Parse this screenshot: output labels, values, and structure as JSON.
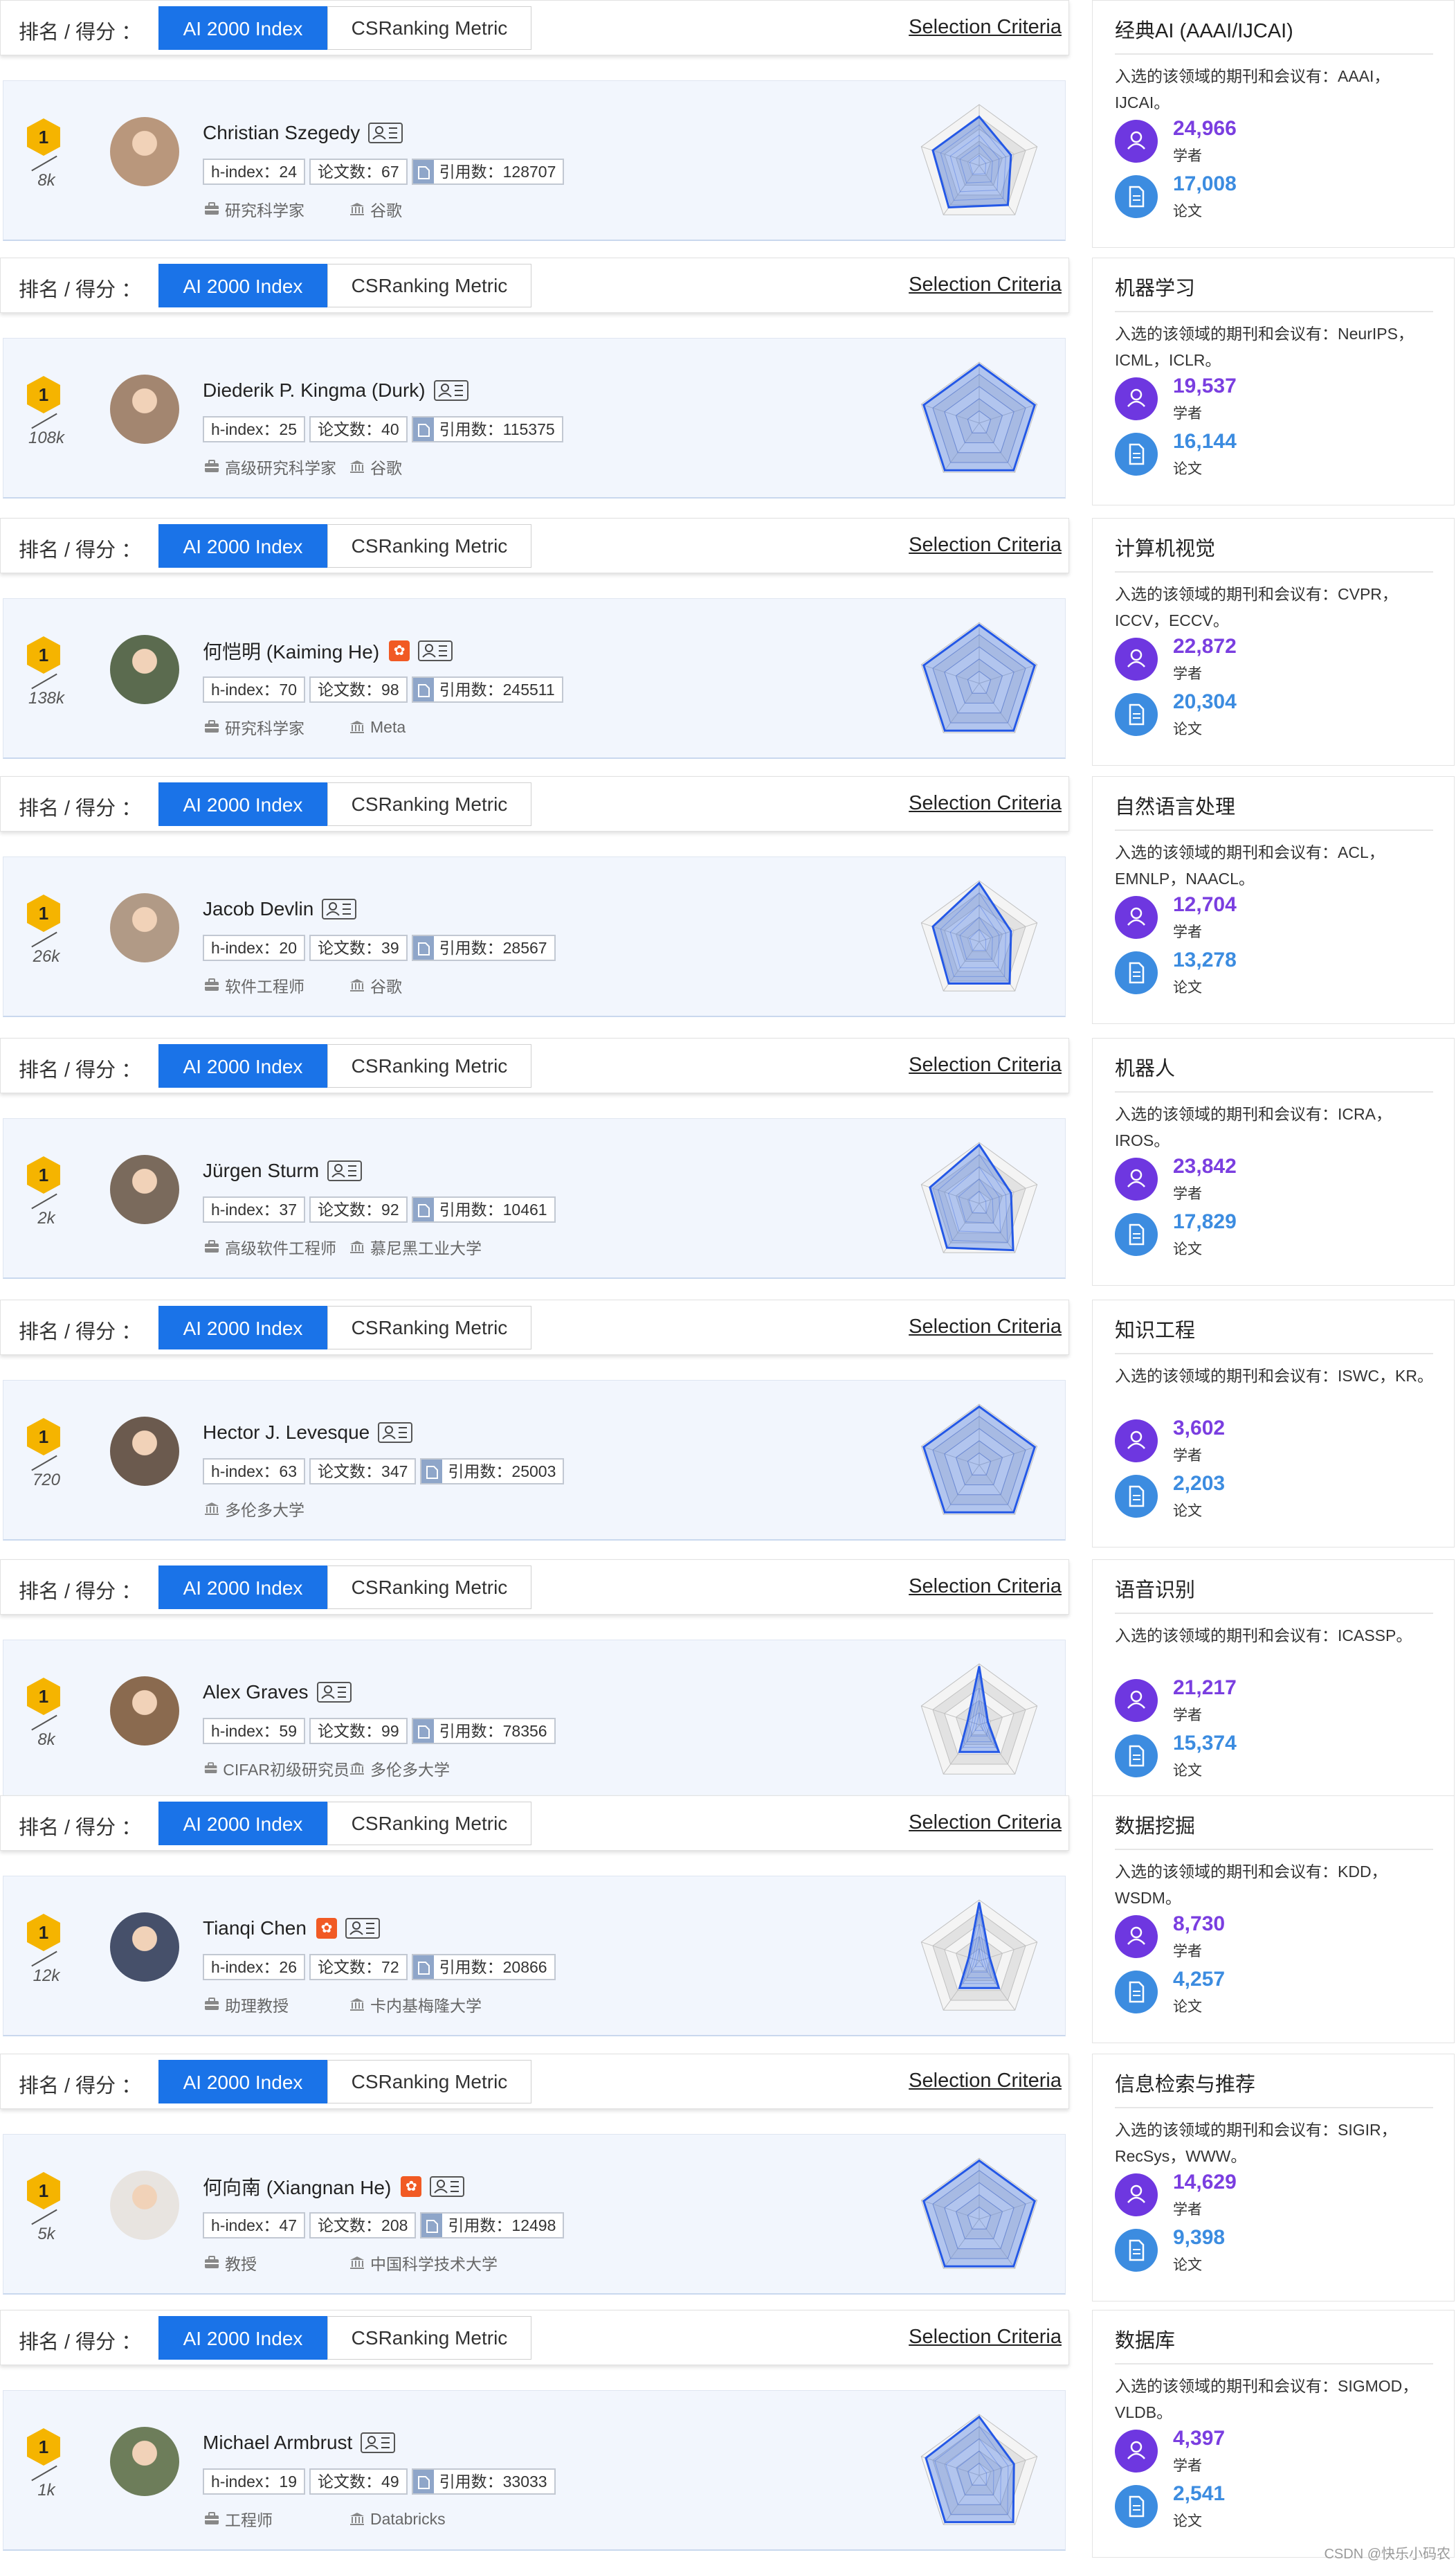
{
  "tabs": {
    "rank_label": "排名 / 得分 ：",
    "ai_index": "AI 2000 Index",
    "csranking": "CSRanking Metric",
    "selection": "Selection Criteria"
  },
  "scholars": [
    {
      "rank": "1",
      "score": "8k",
      "name": "Christian Szegedy",
      "huawei": false,
      "hindex": "h-index：24",
      "papers": "论文数：67",
      "citations": "引用数：128707",
      "position": "研究科学家",
      "org": "谷歌",
      "avatar_color": "#b9977c"
    },
    {
      "rank": "1",
      "score": "108k",
      "name": "Diederik P. Kingma (Durk)",
      "huawei": false,
      "hindex": "h-index：25",
      "papers": "论文数：40",
      "citations": "引用数：115375",
      "position": "高级研究科学家",
      "org": "谷歌",
      "avatar_color": "#a38670"
    },
    {
      "rank": "1",
      "score": "138k",
      "name": "何恺明 (Kaiming He)",
      "huawei": true,
      "hindex": "h-index：70",
      "papers": "论文数：98",
      "citations": "引用数：245511",
      "position": "研究科学家",
      "org": "Meta",
      "avatar_color": "#5b6b4f"
    },
    {
      "rank": "1",
      "score": "26k",
      "name": "Jacob Devlin",
      "huawei": false,
      "hindex": "h-index：20",
      "papers": "论文数：39",
      "citations": "引用数：28567",
      "position": "软件工程师",
      "org": "谷歌",
      "avatar_color": "#b19a86"
    },
    {
      "rank": "1",
      "score": "2k",
      "name": "Jürgen Sturm",
      "huawei": false,
      "hindex": "h-index：37",
      "papers": "论文数：92",
      "citations": "引用数：10461",
      "position": "高级软件工程师",
      "org": "慕尼黑工业大学",
      "avatar_color": "#7a6a5c"
    },
    {
      "rank": "1",
      "score": "720",
      "name": "Hector J. Levesque",
      "huawei": false,
      "hindex": "h-index：63",
      "papers": "论文数：347",
      "citations": "引用数：25003",
      "position": "",
      "org": "多伦多大学",
      "avatar_color": "#6b5a4e"
    },
    {
      "rank": "1",
      "score": "8k",
      "name": "Alex Graves",
      "huawei": false,
      "hindex": "h-index：59",
      "papers": "论文数：99",
      "citations": "引用数：78356",
      "position": "CIFAR初级研究员",
      "org": "多伦多大学",
      "avatar_color": "#8a6a4f"
    },
    {
      "rank": "1",
      "score": "12k",
      "name": "Tianqi Chen",
      "huawei": true,
      "hindex": "h-index：26",
      "papers": "论文数：72",
      "citations": "引用数：20866",
      "position": "助理教授",
      "org": "卡内基梅隆大学",
      "avatar_color": "#46506a"
    },
    {
      "rank": "1",
      "score": "5k",
      "name": "何向南 (Xiangnan He)",
      "huawei": true,
      "hindex": "h-index：47",
      "papers": "论文数：208",
      "citations": "引用数：12498",
      "position": "教授",
      "org": "中国科学技术大学",
      "avatar_color": "#e8e4e0"
    },
    {
      "rank": "1",
      "score": "1k",
      "name": "Michael Armbrust",
      "huawei": false,
      "hindex": "h-index：19",
      "papers": "论文数：49",
      "citations": "引用数：33033",
      "position": "工程师",
      "org": "Databricks",
      "avatar_color": "#6d7d5a"
    }
  ],
  "domains": [
    {
      "title": "经典AI (AAAI/IJCAI)",
      "desc": "入选的该领域的期刊和会议有：AAAI，IJCAI。",
      "scholars": "24,966",
      "papers": "17,008"
    },
    {
      "title": "机器学习",
      "desc": "入选的该领域的期刊和会议有：NeurIPS，ICML，ICLR。",
      "scholars": "19,537",
      "papers": "16,144"
    },
    {
      "title": "计算机视觉",
      "desc": "入选的该领域的期刊和会议有：CVPR，ICCV，ECCV。",
      "scholars": "22,872",
      "papers": "20,304"
    },
    {
      "title": "自然语言处理",
      "desc": "入选的该领域的期刊和会议有：ACL，EMNLP，NAACL。",
      "scholars": "12,704",
      "papers": "13,278"
    },
    {
      "title": "机器人",
      "desc": "入选的该领域的期刊和会议有：ICRA，IROS。",
      "scholars": "23,842",
      "papers": "17,829"
    },
    {
      "title": "知识工程",
      "desc": "入选的该领域的期刊和会议有：ISWC，KR。",
      "scholars": "3,602",
      "papers": "2,203"
    },
    {
      "title": "语音识别",
      "desc": "入选的该领域的期刊和会议有：ICASSP。",
      "scholars": "21,217",
      "papers": "15,374"
    },
    {
      "title": "数据挖掘",
      "desc": "入选的该领域的期刊和会议有：KDD，WSDM。",
      "scholars": "8,730",
      "papers": "4,257"
    },
    {
      "title": "信息检索与推荐",
      "desc": "入选的该领域的期刊和会议有：SIGIR，RecSys，WWW。",
      "scholars": "14,629",
      "papers": "9,398"
    },
    {
      "title": "数据库",
      "desc": "入选的该领域的期刊和会议有：SIGMOD，VLDB。",
      "scholars": "4,397",
      "papers": "2,541"
    }
  ],
  "labels": {
    "scholar": "学者",
    "paper": "论文"
  },
  "watermark": "CSDN @快乐小码农",
  "colors": {
    "accent": "#1a73e8",
    "rank_badge": "#f5b400",
    "huawei": "#f15a24",
    "purple": "#7a3ee0",
    "blue": "#3c8ce0"
  }
}
